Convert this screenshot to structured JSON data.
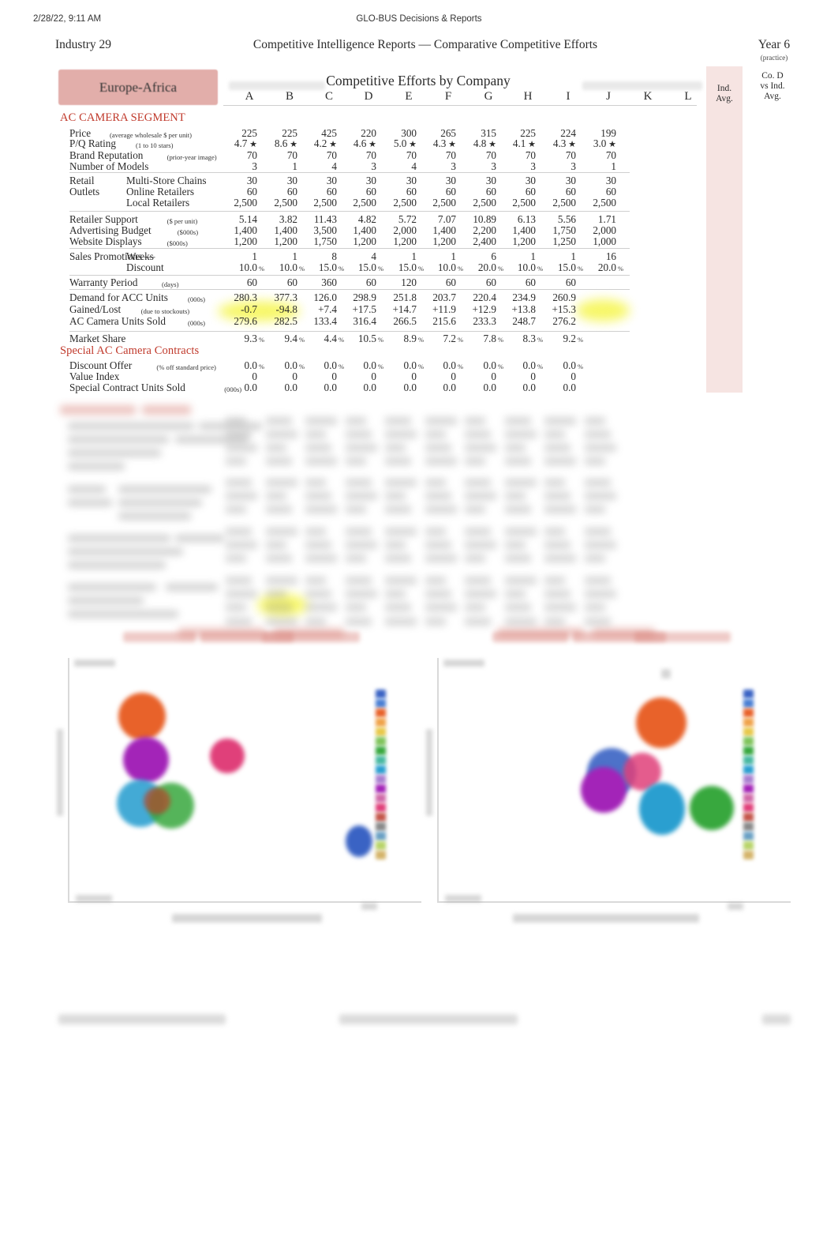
{
  "print_header": {
    "timestamp": "2/28/22, 9:11 AM",
    "doc_title": "GLO-BUS Decisions & Reports"
  },
  "report": {
    "industry": "Industry 29",
    "title": "Competitive Intelligence Reports — Comparative Competitive Efforts",
    "year": "Year 6",
    "year_note": "(practice)",
    "region": "Europe-Africa",
    "table_title": "Competitive Efforts by Company"
  },
  "columns": {
    "companies": [
      "A",
      "B",
      "C",
      "D",
      "E",
      "F",
      "G",
      "H",
      "I",
      "J",
      "K",
      "L"
    ],
    "ind_avg_line1": "Ind.",
    "ind_avg_line2": "Avg.",
    "co_line1": "Co. D",
    "co_line2": "vs Ind.",
    "co_line3": "Avg."
  },
  "sections": {
    "ac_camera_segment": "AC CAMERA SEGMENT",
    "special_contracts": "Special AC Camera Contracts"
  },
  "rows": [
    {
      "label": "Price",
      "unit": "(average wholesale $ per unit)",
      "values": [
        "225",
        "225",
        "425",
        "220",
        "300",
        "265",
        "315",
        "225",
        "224",
        "199"
      ]
    },
    {
      "label": "P/Q Rating",
      "unit": "(1 to 10 stars)",
      "star": true,
      "values": [
        "4.7",
        "8.6",
        "4.2",
        "4.6",
        "5.0",
        "4.3",
        "4.8",
        "4.1",
        "4.3",
        "3.0"
      ]
    },
    {
      "label": "Brand Reputation",
      "unit": "(prior-year image)",
      "values": [
        "70",
        "70",
        "70",
        "70",
        "70",
        "70",
        "70",
        "70",
        "70",
        "70"
      ]
    },
    {
      "label": "Number of Models",
      "unit": "",
      "values": [
        "3",
        "1",
        "4",
        "3",
        "4",
        "3",
        "3",
        "3",
        "3",
        "1"
      ]
    },
    {
      "label": "Retail",
      "label2": "Multi-Store Chains",
      "unit": "",
      "values": [
        "30",
        "30",
        "30",
        "30",
        "30",
        "30",
        "30",
        "30",
        "30",
        "30"
      ]
    },
    {
      "label": "Outlets",
      "label2": "Online Retailers",
      "unit": "",
      "values": [
        "60",
        "60",
        "60",
        "60",
        "60",
        "60",
        "60",
        "60",
        "60",
        "60"
      ]
    },
    {
      "label": "",
      "label2": "Local Retailers",
      "unit": "",
      "values": [
        "2,500",
        "2,500",
        "2,500",
        "2,500",
        "2,500",
        "2,500",
        "2,500",
        "2,500",
        "2,500",
        "2,500"
      ]
    },
    {
      "label": "Retailer Support",
      "unit": "($ per unit)",
      "values": [
        "5.14",
        "3.82",
        "11.43",
        "4.82",
        "5.72",
        "7.07",
        "10.89",
        "6.13",
        "5.56",
        "1.71"
      ]
    },
    {
      "label": "Advertising Budget",
      "unit": "($000s)",
      "values": [
        "1,400",
        "1,400",
        "3,500",
        "1,400",
        "2,000",
        "1,400",
        "2,200",
        "1,400",
        "1,750",
        "2,000"
      ]
    },
    {
      "label": "Website Displays",
      "unit": "($000s)",
      "values": [
        "1,200",
        "1,200",
        "1,750",
        "1,200",
        "1,200",
        "1,200",
        "2,400",
        "1,200",
        "1,250",
        "1,000"
      ]
    },
    {
      "label": "Sales Promotions —",
      "label2": "Weeks",
      "unit": "",
      "values": [
        "1",
        "1",
        "8",
        "4",
        "1",
        "1",
        "6",
        "1",
        "1",
        "16"
      ]
    },
    {
      "label": "",
      "label2": "Discount",
      "unit": "",
      "pct": true,
      "values": [
        "10.0",
        "10.0",
        "15.0",
        "15.0",
        "15.0",
        "10.0",
        "20.0",
        "10.0",
        "15.0",
        "20.0"
      ]
    },
    {
      "label": "Warranty Period",
      "unit": "(days)",
      "values": [
        "60",
        "60",
        "360",
        "60",
        "120",
        "60",
        "60",
        "60",
        "60",
        ""
      ]
    },
    {
      "label": "Demand for ACC Units",
      "unit": "(000s)",
      "values": [
        "280.3",
        "377.3",
        "126.0",
        "298.9",
        "251.8",
        "203.7",
        "220.4",
        "234.9",
        "260.9",
        ""
      ]
    },
    {
      "label": "Gained/Lost",
      "unit": "(due to stockouts)",
      "values": [
        "-0.7",
        "-94.8",
        "+7.4",
        "+17.5",
        "+14.7",
        "+11.9",
        "+12.9",
        "+13.8",
        "+15.3",
        ""
      ]
    },
    {
      "label": "AC Camera Units Sold",
      "unit": "(000s)",
      "values": [
        "279.6",
        "282.5",
        "133.4",
        "316.4",
        "266.5",
        "215.6",
        "233.3",
        "248.7",
        "276.2",
        ""
      ]
    },
    {
      "label": "Market Share",
      "unit": "",
      "pct": true,
      "values": [
        "9.3",
        "9.4",
        "4.4",
        "10.5",
        "8.9",
        "7.2",
        "7.8",
        "8.3",
        "9.2",
        ""
      ]
    }
  ],
  "special_rows": [
    {
      "label": "Discount Offer",
      "unit": "(% off standard price)",
      "pct": true,
      "values": [
        "0.0",
        "0.0",
        "0.0",
        "0.0",
        "0.0",
        "0.0",
        "0.0",
        "0.0",
        "0.0",
        ""
      ]
    },
    {
      "label": "Value Index",
      "unit": "",
      "values": [
        "0",
        "0",
        "0",
        "0",
        "0",
        "0",
        "0",
        "0",
        "0",
        ""
      ]
    },
    {
      "label": "Special Contract Units Sold",
      "unit": "(000s)",
      "values": [
        "0.0",
        "0.0",
        "0.0",
        "0.0",
        "0.0",
        "0.0",
        "0.0",
        "0.0",
        "0.0",
        ""
      ]
    }
  ],
  "redacted": {
    "note": "lower table section and page footer are visually blurred / illegible in the source"
  },
  "colors": {
    "accent_red": "#c0392b",
    "region_badge": "#e2aeaa",
    "ind_avg_band": "#f6e4e2",
    "highlight_yellow": "#f2f20c",
    "text": "#2b2b2b"
  },
  "chart_data": [
    {
      "type": "scatter",
      "title": "(blurred / illegible)",
      "xlabel": "(blurred / illegible)",
      "ylabel": "(blurred / illegible)",
      "legend_position": "right",
      "bubbles": [
        {
          "label": "",
          "x": 0.18,
          "y": 0.82,
          "r": 30,
          "color": "#e8622a"
        },
        {
          "label": "",
          "x": 0.22,
          "y": 0.6,
          "r": 28,
          "color": "#a324b8"
        },
        {
          "label": "",
          "x": 0.17,
          "y": 0.44,
          "r": 29,
          "color": "#2a9fd0"
        },
        {
          "label": "",
          "x": 0.26,
          "y": 0.43,
          "r": 27,
          "color": "#38a83e"
        },
        {
          "label": "",
          "x": 0.23,
          "y": 0.45,
          "r": 18,
          "color": "#b8452a"
        },
        {
          "label": "",
          "x": 0.5,
          "y": 0.63,
          "r": 20,
          "color": "#e0407a"
        },
        {
          "label": "",
          "x": 0.88,
          "y": 0.22,
          "r": 18,
          "color": "#3a63c4"
        }
      ]
    },
    {
      "type": "scatter",
      "title": "(blurred / illegible)",
      "xlabel": "(blurred / illegible)",
      "ylabel": "(blurred / illegible)",
      "legend_position": "right",
      "bubbles": [
        {
          "label": "",
          "x": 0.64,
          "y": 0.74,
          "r": 31,
          "color": "#e8622a"
        },
        {
          "label": "",
          "x": 0.48,
          "y": 0.53,
          "r": 29,
          "color": "#3a63c4"
        },
        {
          "label": "",
          "x": 0.46,
          "y": 0.48,
          "r": 28,
          "color": "#a324b8"
        },
        {
          "label": "",
          "x": 0.56,
          "y": 0.52,
          "r": 22,
          "color": "#e0407a"
        },
        {
          "label": "",
          "x": 0.62,
          "y": 0.42,
          "r": 28,
          "color": "#2a9fd0"
        },
        {
          "label": "",
          "x": 0.76,
          "y": 0.42,
          "r": 26,
          "color": "#38a83e"
        }
      ]
    }
  ]
}
